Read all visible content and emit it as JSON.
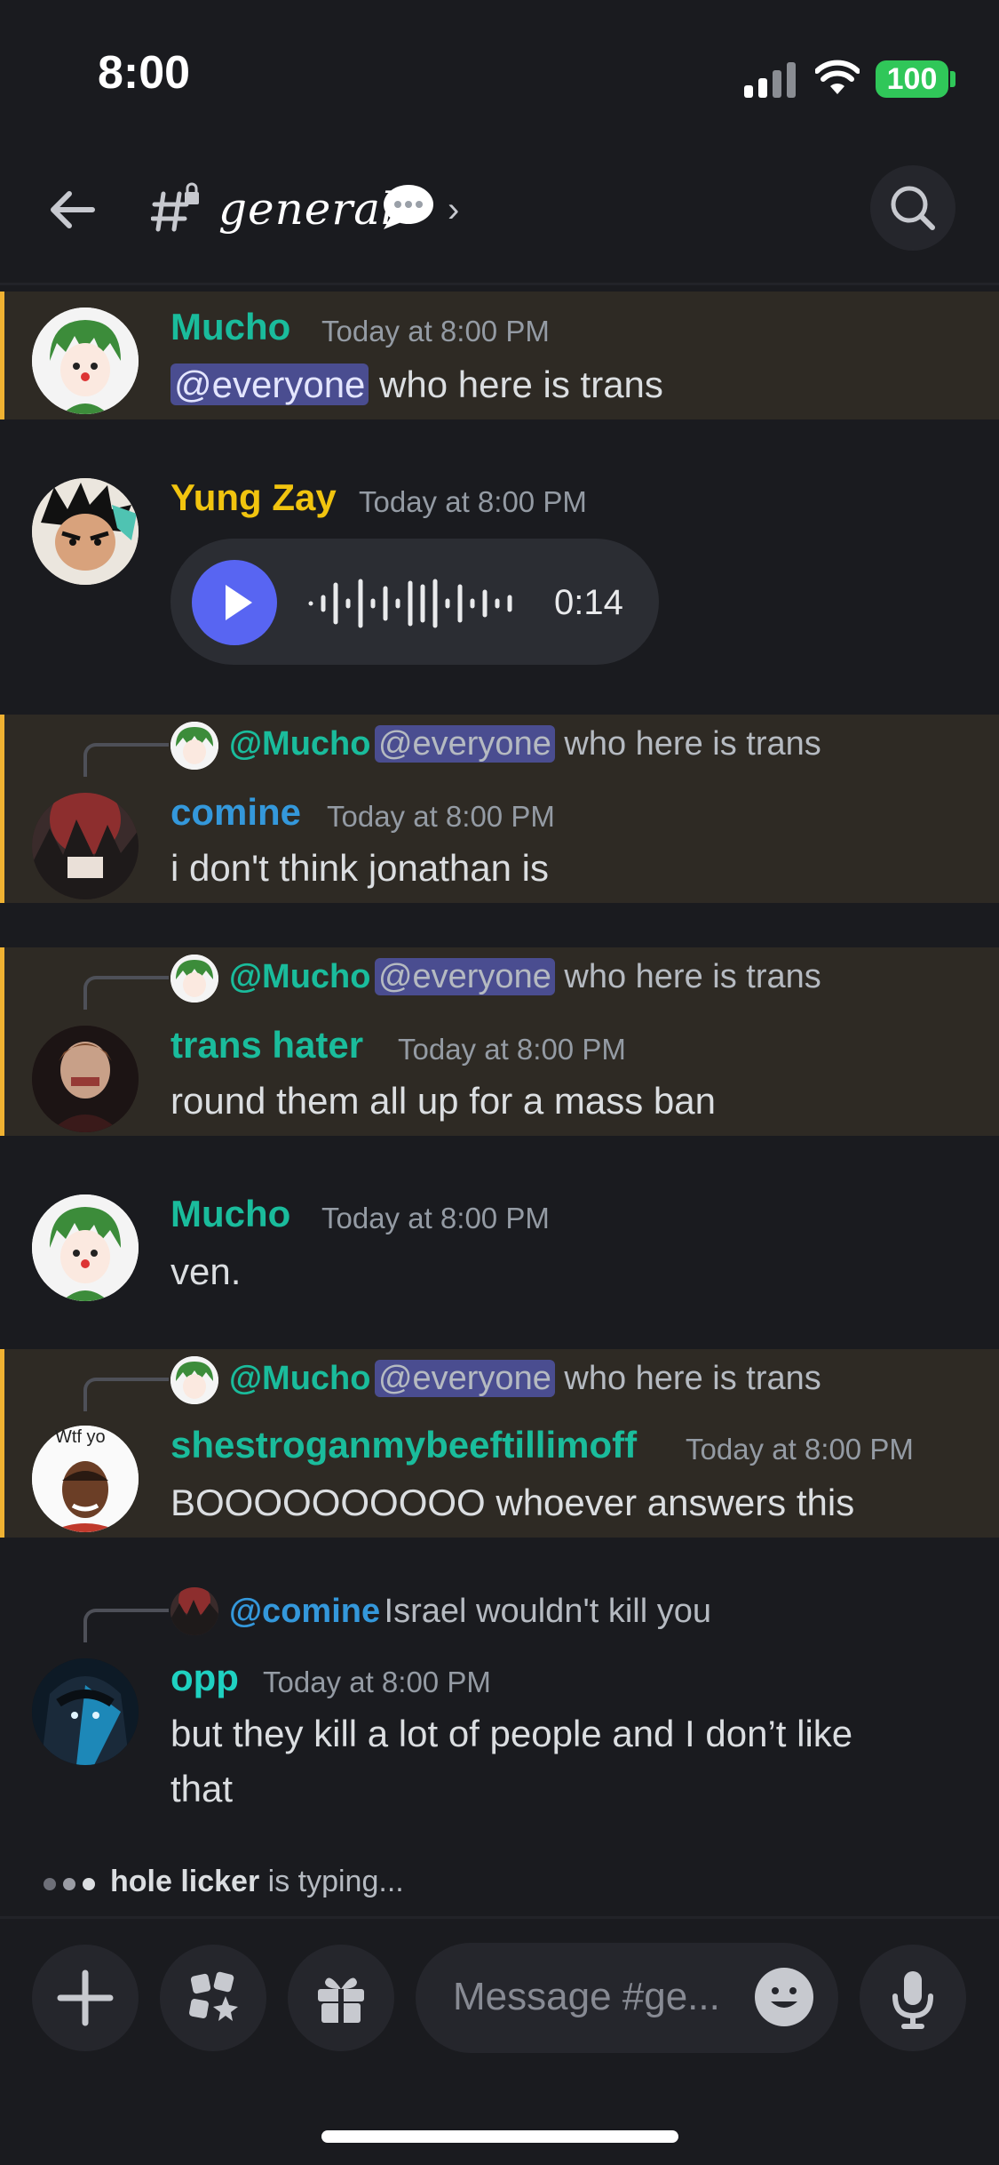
{
  "status_bar": {
    "time": "8:00",
    "battery": "100"
  },
  "header": {
    "channel": "general",
    "hash": "#"
  },
  "messages": [
    {
      "author": "Mucho",
      "author_color": "#1abc9c",
      "time": "Today at 8:00 PM",
      "mention": "@everyone",
      "text": " who here is trans",
      "highlighted": true
    },
    {
      "author": "Yung Zay",
      "author_color": "#f1c40f",
      "time": "Today at 8:00 PM",
      "voice_duration": "0:14"
    },
    {
      "reply": {
        "author": "@Mucho",
        "mention": "@everyone",
        "text": " who here is trans"
      },
      "author": "comine",
      "author_color": "#3498db",
      "time": "Today at 8:00 PM",
      "text": "i don't think jonathan is",
      "highlighted": true
    },
    {
      "reply": {
        "author": "@Mucho",
        "mention": "@everyone",
        "text": " who here is trans"
      },
      "author": "trans hater",
      "author_color": "#1abc9c",
      "time": "Today at 8:00 PM",
      "text": "round them all up for a mass ban",
      "highlighted": true
    },
    {
      "author": "Mucho",
      "author_color": "#1abc9c",
      "time": "Today at 8:00 PM",
      "text": "ven."
    },
    {
      "reply": {
        "author": "@Mucho",
        "mention": "@everyone",
        "text": " who here is trans"
      },
      "author": "shestroganmybeeftillimoff",
      "author_color": "#1abc9c",
      "avatar_label": "Wtf yo",
      "time": "Today at 8:00 PM",
      "text": "BOOOOOOOOOO whoever answers this",
      "highlighted": true
    },
    {
      "reply": {
        "author": "@comine",
        "text": "Israel wouldn't kill you"
      },
      "author": "opp",
      "author_color": "#1fd1c1",
      "time": "Today at 8:00 PM",
      "text_line1": "but they kill a lot of people and I don’t like",
      "text_line2": "that"
    }
  ],
  "typing": {
    "user": "hole licker",
    "suffix": " is typing..."
  },
  "composer": {
    "placeholder": "Message #ge..."
  },
  "colors": {
    "background": "#1a1b1f",
    "highlight": "#2e2a24",
    "highlight_bar": "#f0b232",
    "mention_bg": "#4a4d90",
    "blurple": "#5865f2"
  }
}
